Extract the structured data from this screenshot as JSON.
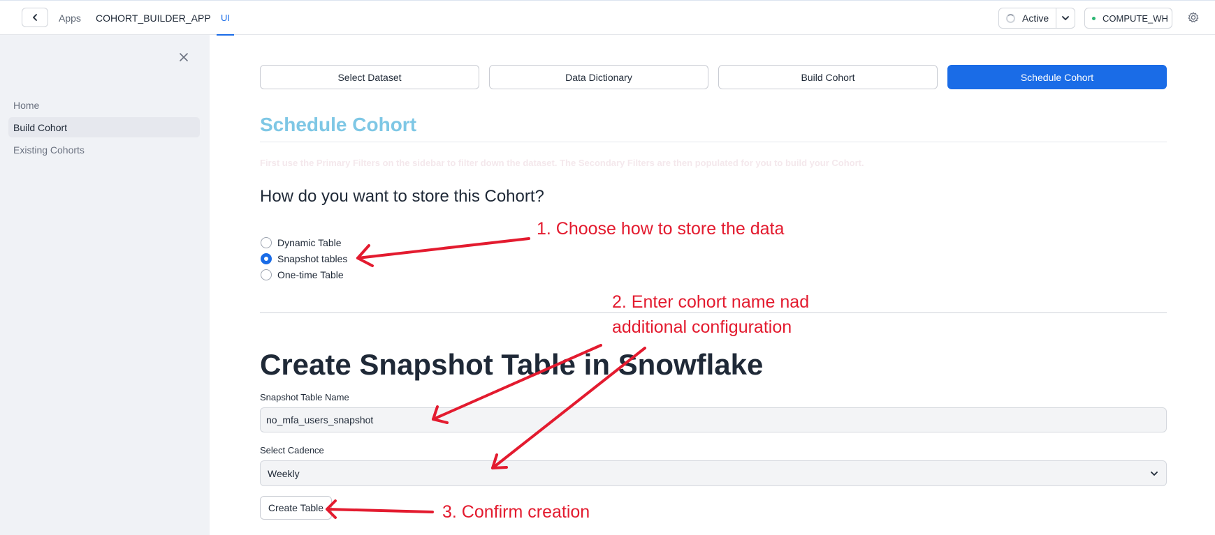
{
  "topbar": {
    "apps_label": "Apps",
    "app_name": "COHORT_BUILDER_APP",
    "tab_ui": "UI",
    "status_label": "Active",
    "warehouse_label": "COMPUTE_WH"
  },
  "sidebar": {
    "items": [
      {
        "label": "Home"
      },
      {
        "label": "Build Cohort"
      },
      {
        "label": "Existing Cohorts"
      }
    ]
  },
  "steps": [
    {
      "label": "Select Dataset"
    },
    {
      "label": "Data Dictionary"
    },
    {
      "label": "Build Cohort"
    },
    {
      "label": "Schedule Cohort"
    }
  ],
  "main": {
    "section_title": "Schedule Cohort",
    "faded_text": "First use the Primary Filters on the sidebar to filter down the dataset. The Secondary Filters are then populated for you to build your Cohort.",
    "question": "How do you want to store this Cohort?",
    "storage_options": [
      {
        "label": "Dynamic Table",
        "checked": false
      },
      {
        "label": "Snapshot tables",
        "checked": true
      },
      {
        "label": "One-time Table",
        "checked": false
      }
    ],
    "create_title": "Create Snapshot Table in Snowflake",
    "table_name_label": "Snapshot Table Name",
    "table_name_value": "no_mfa_users_snapshot",
    "cadence_label": "Select Cadence",
    "cadence_value": "Weekly",
    "create_button": "Create Table"
  },
  "annotations": {
    "step1": "1. Choose how to store the data",
    "step2_line1": "2. Enter cohort name nad",
    "step2_line2": "additional configuration",
    "step3": "3. Confirm creation"
  },
  "colors": {
    "accent": "#1a6ce7",
    "section_title": "#7ec7e5",
    "annotation": "#e31b2f"
  }
}
